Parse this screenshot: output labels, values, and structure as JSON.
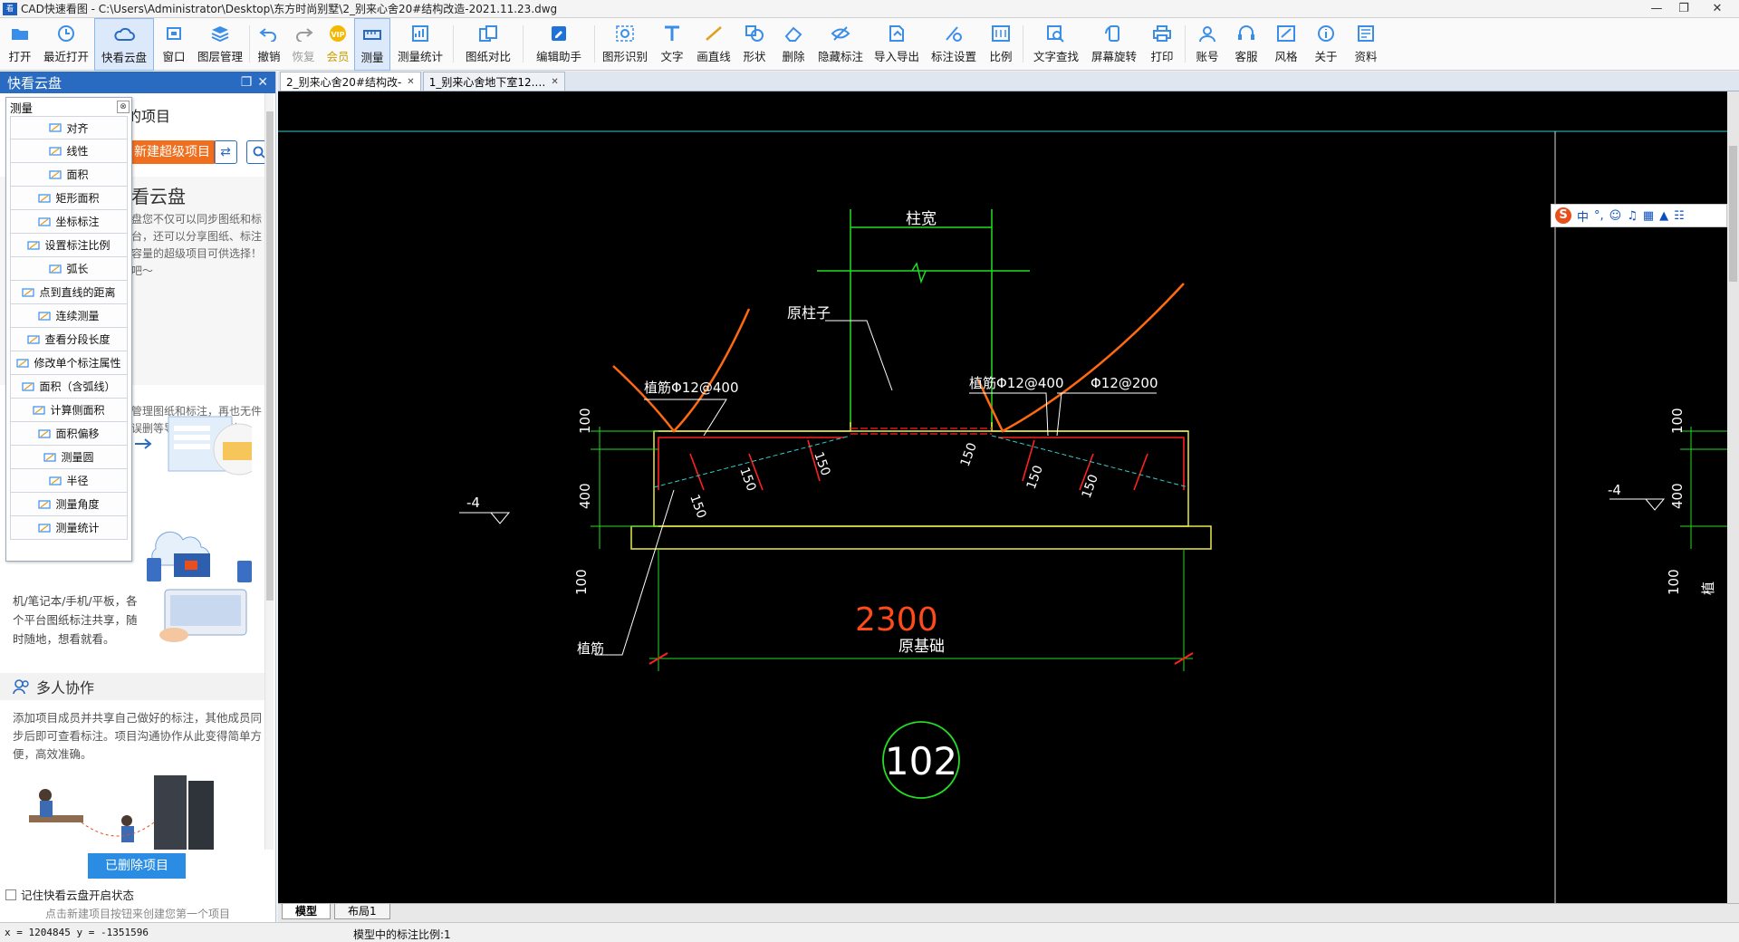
{
  "window": {
    "title": "CAD快速看图 - C:\\Users\\Administrator\\Desktop\\东方时尚别墅\\2_别来心舍20#结构改造-2021.11.23.dwg"
  },
  "toolbar": {
    "items": [
      {
        "label": "打开",
        "icon": "folder-open-icon"
      },
      {
        "label": "最近打开",
        "icon": "clock-icon"
      },
      {
        "label": "快看云盘",
        "icon": "cloud-icon"
      },
      {
        "label": "窗口",
        "icon": "window-icon"
      },
      {
        "label": "图层管理",
        "icon": "layers-icon"
      },
      {
        "label": "撤销",
        "icon": "undo-icon"
      },
      {
        "label": "恢复",
        "icon": "redo-icon"
      },
      {
        "label": "会员",
        "icon": "vip-icon"
      },
      {
        "label": "测量",
        "icon": "ruler-icon"
      },
      {
        "label": "测量统计",
        "icon": "measure-stats-icon"
      },
      {
        "label": "图纸对比",
        "icon": "compare-icon"
      },
      {
        "label": "编辑助手",
        "icon": "edit-assist-icon"
      },
      {
        "label": "图形识别",
        "icon": "shape-recognize-icon"
      },
      {
        "label": "文字",
        "icon": "text-icon"
      },
      {
        "label": "画直线",
        "icon": "line-icon"
      },
      {
        "label": "形状",
        "icon": "shape-icon"
      },
      {
        "label": "删除",
        "icon": "eraser-icon"
      },
      {
        "label": "隐藏标注",
        "icon": "eye-hide-icon"
      },
      {
        "label": "导入导出",
        "icon": "import-export-icon"
      },
      {
        "label": "标注设置",
        "icon": "annotation-settings-icon"
      },
      {
        "label": "比例",
        "icon": "scale-icon"
      },
      {
        "label": "文字查找",
        "icon": "text-search-icon"
      },
      {
        "label": "屏幕旋转",
        "icon": "rotate-screen-icon"
      },
      {
        "label": "打印",
        "icon": "printer-icon"
      },
      {
        "label": "账号",
        "icon": "account-icon"
      },
      {
        "label": "客服",
        "icon": "headset-icon"
      },
      {
        "label": "风格",
        "icon": "style-icon"
      },
      {
        "label": "关于",
        "icon": "info-icon"
      },
      {
        "label": "资料",
        "icon": "documents-icon"
      }
    ]
  },
  "left_panel": {
    "header": "快看云盘",
    "projects_title": "的项目",
    "new_project_button": "新建超级项目",
    "intro_title": "看云盘",
    "intro_text": "盘您不仅可以同步图纸和标台，还可以分享图纸、标注容量的超级项目可供选择！吧～",
    "intro_text2": "管理图纸和标注，再也无件误删等导致标注丢失的",
    "device_text": "机/笔记本/手机/平板，各个平台图纸标注共享，随时随地，想看就看。",
    "collab_title": "多人协作",
    "collab_text": "添加项目成员并共享自己做好的标注，其他成员同步后即可查看标注。项目沟通协作从此变得简单方便，高效准确。",
    "deleted_projects_button": "已删除项目",
    "remember_checkbox_label": "记住快看云盘开启状态",
    "hint": "点击新建项目按钮来创建您第一个项目"
  },
  "measure_menu": {
    "title": "测量",
    "items": [
      "对齐",
      "线性",
      "面积",
      "矩形面积",
      "坐标标注",
      "设置标注比例",
      "弧长",
      "点到直线的距离",
      "连续测量",
      "查看分段长度",
      "修改单个标注属性",
      "面积（含弧线）",
      "计算侧面积",
      "面积偏移",
      "测量圆",
      "半径",
      "测量角度",
      "测量统计"
    ]
  },
  "doc_tabs": [
    {
      "label": "2_别来心舍20#结构改-",
      "active": true
    },
    {
      "label": "1_别来心舍地下室12.…",
      "active": false
    }
  ],
  "layout_tabs": [
    {
      "label": "模型",
      "active": true
    },
    {
      "label": "布局1",
      "active": false
    }
  ],
  "ime": {
    "label": "中"
  },
  "drawing": {
    "colors": {
      "bg": "#000000",
      "green": "#22dd22",
      "yellow": "#e8e84a",
      "red": "#ff2020",
      "orange": "#ff6a10",
      "white": "#ffffff",
      "cyan": "#33cccc"
    },
    "labels": {
      "column_width": "柱宽",
      "original_column": "原柱子",
      "left_rebar": "植筋Φ12@400",
      "right_rebar": "植筋Φ12@400",
      "right_rebar2": "Φ12@200",
      "dim_150_a": "150",
      "dim_150_b": "150",
      "dim_150_c": "150",
      "dim_150_d": "150",
      "dim_150_e": "150",
      "dim_150_f": "150",
      "dim_100_top": "100",
      "dim_400": "400",
      "dim_100_bottom": "100",
      "level_left": "-4",
      "total_width": "2300",
      "original_foundation": "原基础",
      "plant_rebar": "植筋",
      "detail_number": "102",
      "right_dim_100_top": "100",
      "right_dim_400": "400",
      "right_dim_100_bottom": "100",
      "right_level": "-4",
      "right_edge_label": "植"
    }
  },
  "status": {
    "coords": "x = 1204845  y = -1351596",
    "scale": "模型中的标注比例:1"
  }
}
